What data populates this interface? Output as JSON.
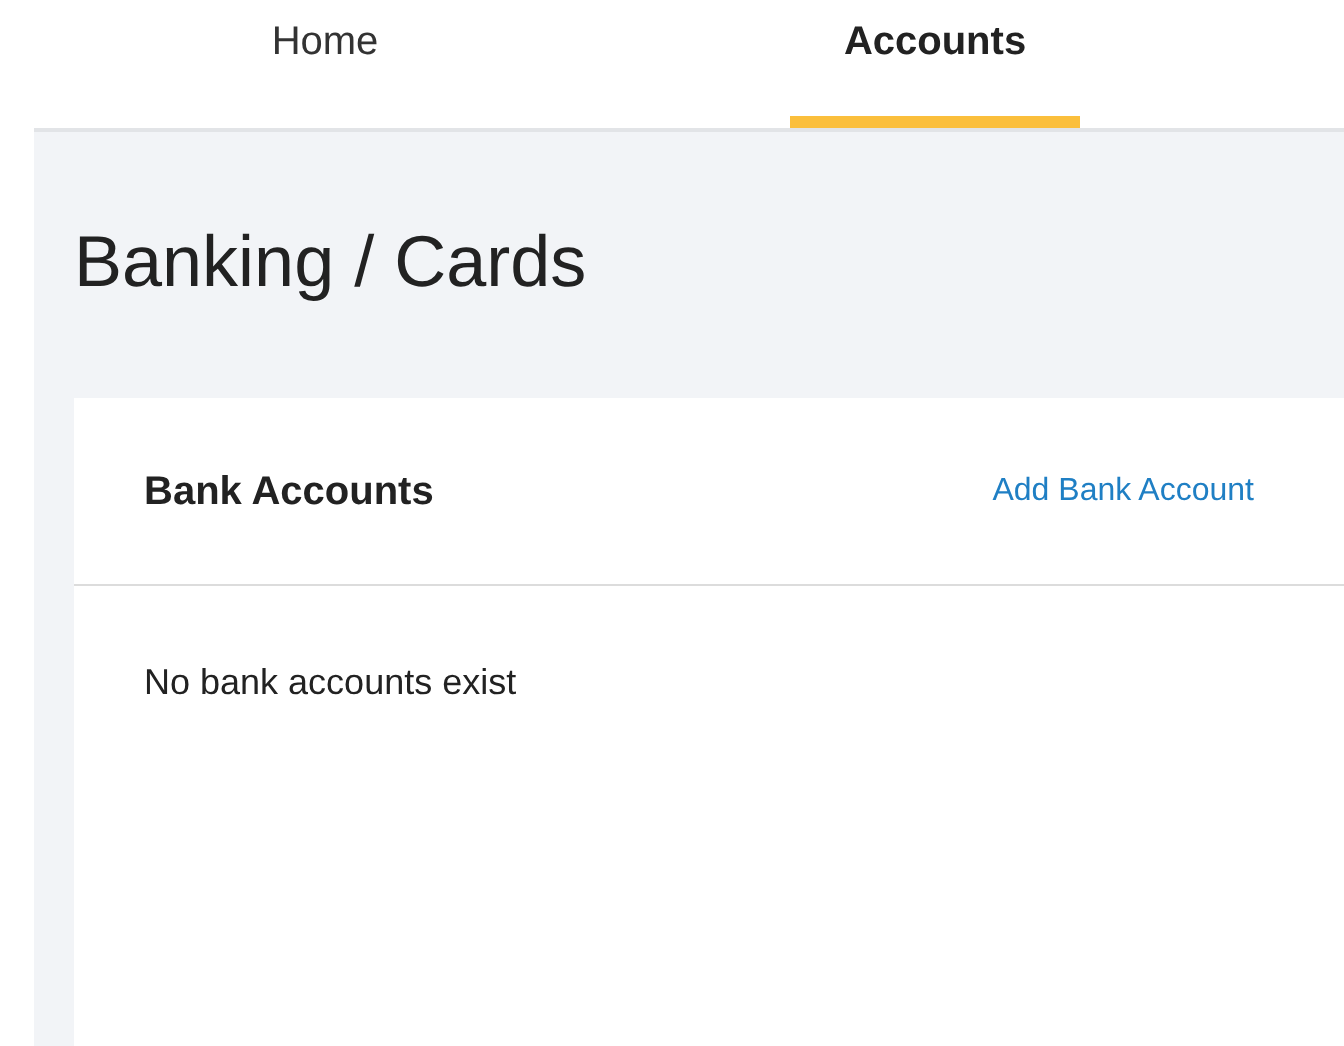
{
  "tabs": [
    {
      "label": "Home",
      "selected": false
    },
    {
      "label": "Accounts",
      "selected": true
    }
  ],
  "page_title": "Banking / Cards",
  "card": {
    "title": "Bank Accounts",
    "action": "Add Bank Account",
    "empty_message": "No bank accounts exist"
  }
}
